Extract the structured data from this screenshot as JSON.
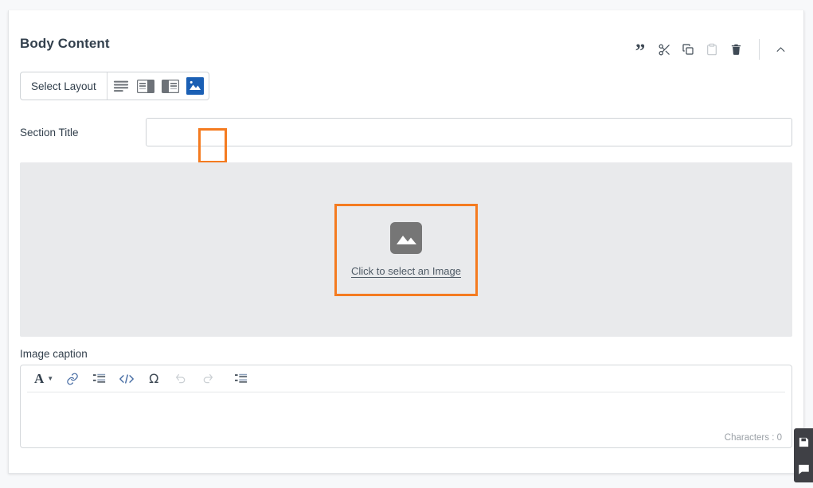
{
  "theme": {
    "accent_blue": "#17569b",
    "highlight_orange": "#f47b20",
    "selected_blue": "#1a5fb4",
    "image_area_gray": "#e9eaec",
    "rail_dark": "#3f4045"
  },
  "panel": {
    "title": "Body Content",
    "header_actions": [
      {
        "name": "quote-icon",
        "label": "Quote",
        "disabled": false
      },
      {
        "name": "cut-icon",
        "label": "Cut",
        "disabled": false
      },
      {
        "name": "copy-icon",
        "label": "Copy",
        "disabled": false
      },
      {
        "name": "paste-icon",
        "label": "Paste",
        "disabled": true
      },
      {
        "name": "trash-icon",
        "label": "Delete",
        "disabled": false
      },
      {
        "name": "chevron-up-icon",
        "label": "Collapse",
        "disabled": false
      }
    ]
  },
  "layout_selector": {
    "label": "Select Layout",
    "options": [
      {
        "name": "layout-text-only",
        "label": "Text only",
        "selected": false
      },
      {
        "name": "layout-text-left-image-right",
        "label": "Text left, image right",
        "selected": false
      },
      {
        "name": "layout-image-left-text-right",
        "label": "Image left, text right",
        "selected": false
      },
      {
        "name": "layout-image-only",
        "label": "Image only",
        "selected": true
      }
    ],
    "selected_index": 3,
    "selected_highlighted": true
  },
  "section_title": {
    "label": "Section Title",
    "value": "",
    "placeholder": ""
  },
  "image_block": {
    "picker_link_text": "Click to select an Image",
    "picker_icon": "image-placeholder-icon",
    "highlighted": true,
    "has_image": false
  },
  "caption": {
    "label": "Image caption",
    "value": "",
    "character_count_text": "Characters : 0",
    "toolbar": [
      {
        "name": "font-style-icon",
        "label": "A",
        "has_caret": true,
        "disabled": false
      },
      {
        "name": "link-icon",
        "label": "Insert link",
        "disabled": false
      },
      {
        "name": "ordered-list-icon",
        "label": "Ordered list",
        "disabled": false
      },
      {
        "name": "source-code-icon",
        "label": "Source code",
        "disabled": false
      },
      {
        "name": "special-character-icon",
        "label": "Ω",
        "disabled": false
      },
      {
        "name": "undo-icon",
        "label": "Undo",
        "disabled": true
      },
      {
        "name": "redo-icon",
        "label": "Redo",
        "disabled": true
      },
      {
        "name": "list-settings-icon",
        "label": "List settings",
        "disabled": false
      }
    ]
  },
  "right_rail": {
    "buttons": [
      {
        "name": "save-icon",
        "label": "Save"
      },
      {
        "name": "comment-icon",
        "label": "Comments"
      }
    ]
  }
}
